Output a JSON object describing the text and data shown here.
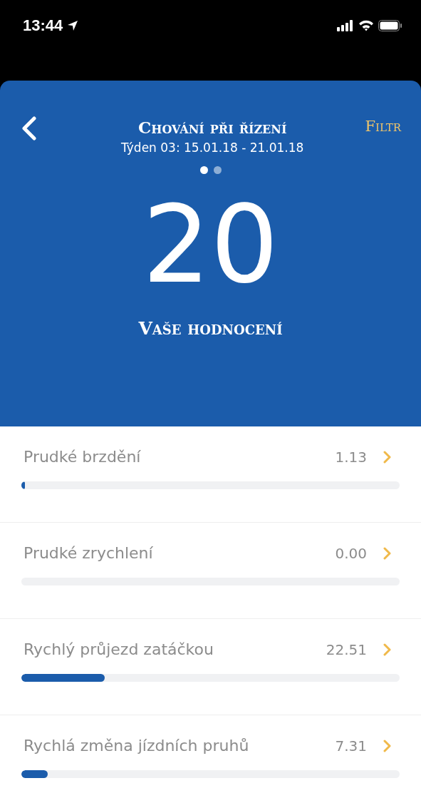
{
  "status_bar": {
    "time": "13:44"
  },
  "header": {
    "title": "Chování při řízení",
    "subtitle": "Týden 03: 15.01.18 - 21.01.18",
    "filter": "Filtr"
  },
  "pages": [
    {
      "selected": true
    },
    {
      "selected": false
    }
  ],
  "score": {
    "value": "20",
    "label": "Vaše hodnocení"
  },
  "metrics": [
    {
      "name": "Prudké brzdění",
      "value": "1.13",
      "level": 0.01
    },
    {
      "name": "Prudké zrychlení",
      "value": "0.00"
    },
    {
      "name": "Rychlý průjezd zatáčkou",
      "value": "22.51",
      "level": 0.22
    },
    {
      "name": "Rychlá změna jízdních pruhů",
      "value": "7.31",
      "level": 0.07
    }
  ]
}
